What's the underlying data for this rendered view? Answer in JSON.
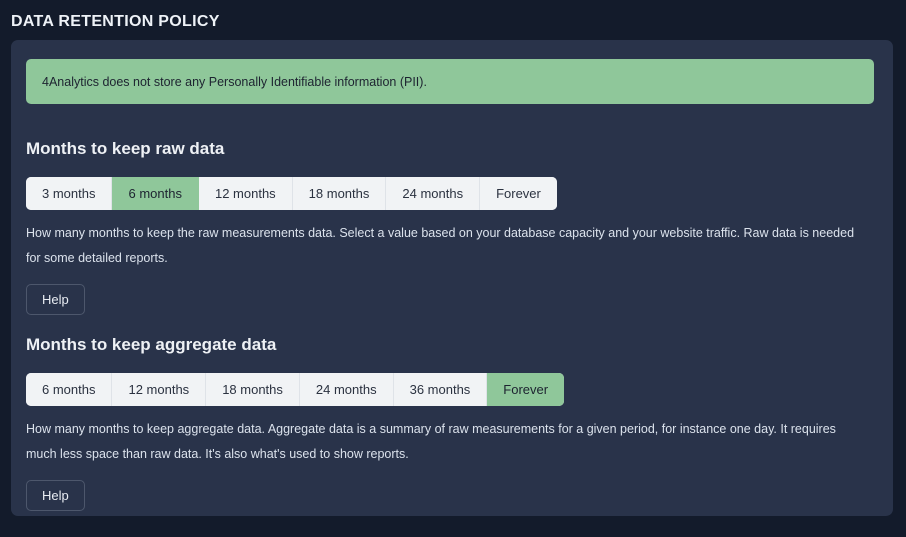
{
  "page": {
    "title": "DATA RETENTION POLICY"
  },
  "alert": {
    "text": "4Analytics does not store any Personally Identifiable information (PII)."
  },
  "sections": [
    {
      "heading": "Months to keep raw data",
      "options": [
        "3 months",
        "6 months",
        "12 months",
        "18 months",
        "24 months",
        "Forever"
      ],
      "selected": "6 months",
      "description": "How many months to keep the raw measurements data. Select a value based on your database capacity and your website traffic. Raw data is needed for some detailed reports.",
      "help_label": "Help"
    },
    {
      "heading": "Months to keep aggregate data",
      "options": [
        "6 months",
        "12 months",
        "18 months",
        "24 months",
        "36 months",
        "Forever"
      ],
      "selected": "Forever",
      "description": "How many months to keep aggregate data. Aggregate data is a summary of raw measurements for a given period, for instance one day. It requires much less space than raw data. It's also what's used to show reports.",
      "help_label": "Help"
    }
  ],
  "colors": {
    "page_background": "#131b2b",
    "card_background": "#29334a",
    "accent_green": "#8fc79a",
    "button_background": "#f1f3f5",
    "text_light": "#e8ecf2"
  }
}
